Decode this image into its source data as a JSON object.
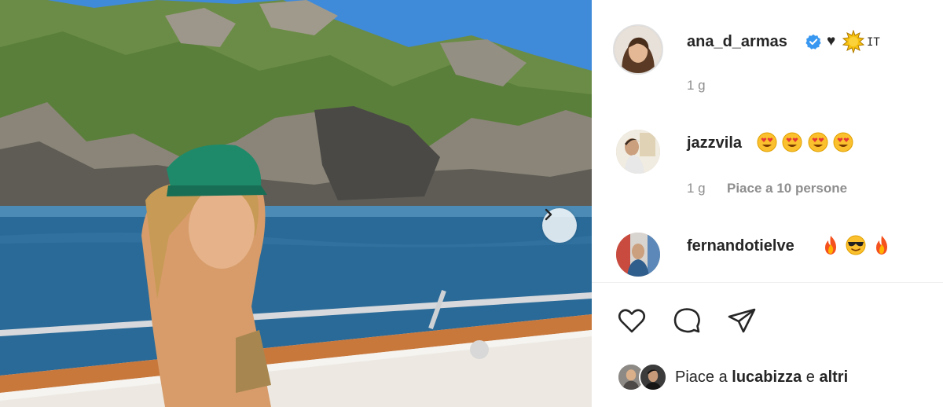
{
  "post": {
    "owner": {
      "username": "ana_d_armas",
      "bio_suffix": "♥",
      "country_code": "IT",
      "time": "1 g"
    },
    "comments": [
      {
        "username": "jazzvila",
        "emoji": [
          "heart-eyes",
          "heart-eyes",
          "heart-eyes",
          "heart-eyes"
        ],
        "time": "1 g",
        "likes": "Piace a 10 persone"
      },
      {
        "username": "fernandotielve",
        "emoji": [
          "fire",
          "sunglasses",
          "fire"
        ]
      }
    ],
    "likes": {
      "prefix": "Piace a",
      "user": "lucabizza",
      "joiner": "e",
      "suffix": "altri"
    },
    "colors": {
      "verified": "#3897f0",
      "text_secondary": "#8e8e8e",
      "text_primary": "#262626"
    },
    "icons": {
      "like": "heart-outline-icon",
      "comment": "comment-bubble-icon",
      "share": "paper-plane-icon",
      "carousel_next": "chevron-right-icon"
    }
  }
}
